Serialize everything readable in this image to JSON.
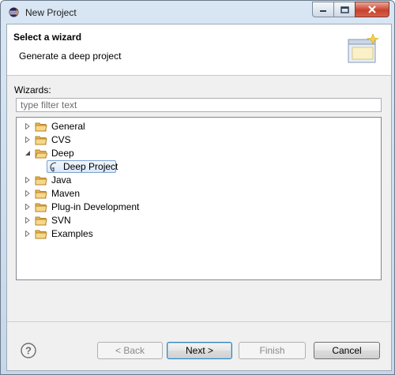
{
  "window": {
    "title": "New Project"
  },
  "banner": {
    "title": "Select a wizard",
    "message": "Generate a deep project"
  },
  "wizards": {
    "label": "Wizards:",
    "filter_placeholder": "type filter text"
  },
  "tree": {
    "items": [
      {
        "label": "General",
        "expanded": false
      },
      {
        "label": "CVS",
        "expanded": false
      },
      {
        "label": "Deep",
        "expanded": true,
        "children": [
          {
            "label": "Deep Project",
            "selected": true
          }
        ]
      },
      {
        "label": "Java",
        "expanded": false
      },
      {
        "label": "Maven",
        "expanded": false
      },
      {
        "label": "Plug-in Development",
        "expanded": false
      },
      {
        "label": "SVN",
        "expanded": false
      },
      {
        "label": "Examples",
        "expanded": false
      }
    ]
  },
  "buttons": {
    "back": "< Back",
    "next": "Next >",
    "finish": "Finish",
    "cancel": "Cancel"
  }
}
